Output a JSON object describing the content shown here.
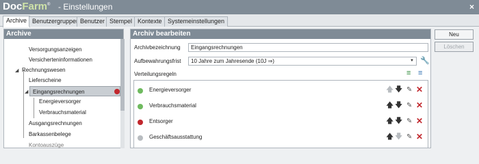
{
  "window": {
    "brand_doc": "Doc",
    "brand_farm": "Farm",
    "brand_reg": "®",
    "title": "-  Einstellungen",
    "close_glyph": "×"
  },
  "tabs": [
    "Archive",
    "Benutzergruppen",
    "Benutzer",
    "Stempel",
    "Kontexte",
    "Systemeinstellungen"
  ],
  "active_tab": "Archive",
  "archive_panel": {
    "header": "Archive",
    "tree": [
      {
        "label": "Versorgungsanzeigen"
      },
      {
        "label": "Versicherteninformationen"
      },
      {
        "label": "Rechnungswesen",
        "expanded": true
      },
      {
        "label": "Lieferscheine"
      },
      {
        "label": "Eingangsrechnungen",
        "expanded": true,
        "selected": true,
        "status_color": "#c1272d"
      },
      {
        "label": "Energieversorger"
      },
      {
        "label": "Verbrauchsmaterial"
      },
      {
        "label": "Ausgangsrechnungen"
      },
      {
        "label": "Barkassenbelege"
      },
      {
        "label": "Kontoauszüge"
      }
    ]
  },
  "edit_panel": {
    "header": "Archiv bearbeiten",
    "name_label": "Archivbezeichnung",
    "name_value": "Eingangsrechnungen",
    "retention_label": "Aufbewahrungsfrist",
    "retention_value": "10 Jahre zum Jahresende (10J ⇒)",
    "rules_label": "Verteilungsregeln",
    "rules": [
      {
        "name": "Energieversorger",
        "color": "#6fba5f",
        "up_enabled": false,
        "down_enabled": true
      },
      {
        "name": "Verbrauchsmaterial",
        "color": "#6fba5f",
        "up_enabled": true,
        "down_enabled": true
      },
      {
        "name": "Entsorger",
        "color": "#c1272d",
        "up_enabled": true,
        "down_enabled": true
      },
      {
        "name": "Geschäftsausstattung",
        "color": "#b8bcc0",
        "up_enabled": true,
        "down_enabled": false
      }
    ]
  },
  "buttons": {
    "new_label": "Neu",
    "delete_label": "Löschen"
  }
}
